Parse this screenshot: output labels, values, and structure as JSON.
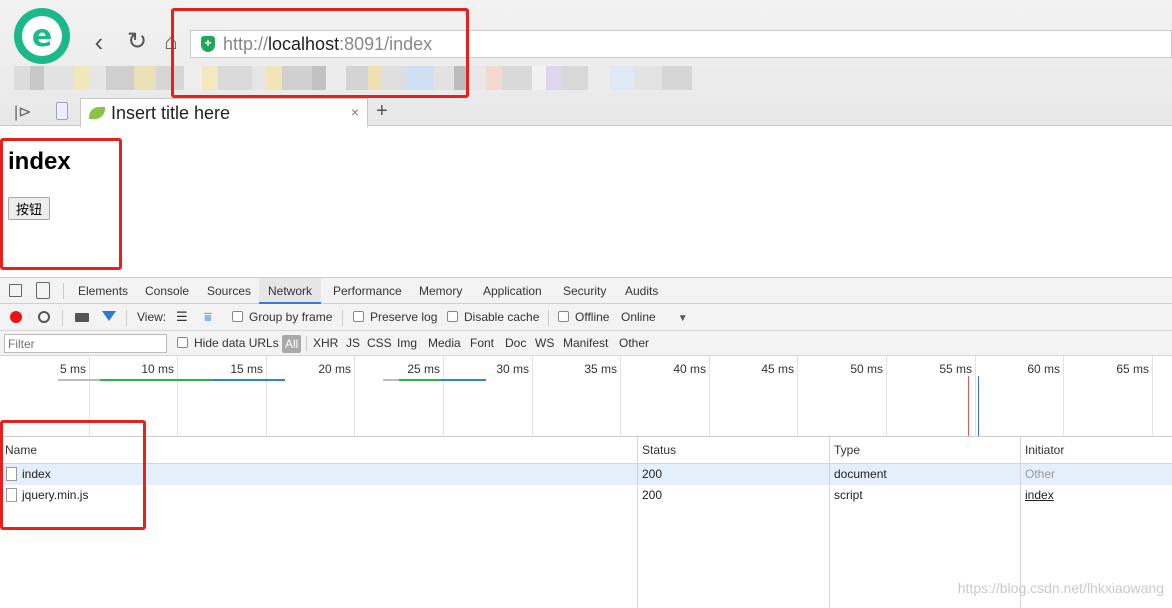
{
  "browser": {
    "address_scheme": "http://",
    "address_host": "localhost",
    "address_rest": ":8091/index",
    "tab_title": "Insert title here",
    "close_glyph": "×",
    "new_tab_glyph": "+"
  },
  "page": {
    "heading": "index",
    "button_label": "按钮"
  },
  "devtools": {
    "tabs": [
      "Elements",
      "Console",
      "Sources",
      "Network",
      "Performance",
      "Memory",
      "Application",
      "Security",
      "Audits"
    ],
    "active_tab": "Network",
    "toolbar": {
      "view_label": "View:",
      "group_by_frame": "Group by frame",
      "preserve_log": "Preserve log",
      "disable_cache": "Disable cache",
      "offline": "Offline",
      "throttling": "Online"
    },
    "filter": {
      "placeholder": "Filter",
      "hide_data_urls": "Hide data URLs",
      "types": [
        "All",
        "XHR",
        "JS",
        "CSS",
        "Img",
        "Media",
        "Font",
        "Doc",
        "WS",
        "Manifest",
        "Other"
      ]
    },
    "timeline_ticks": [
      "5 ms",
      "10 ms",
      "15 ms",
      "20 ms",
      "25 ms",
      "30 ms",
      "35 ms",
      "40 ms",
      "45 ms",
      "50 ms",
      "55 ms",
      "60 ms",
      "65 ms"
    ],
    "columns": {
      "name": "Name",
      "status": "Status",
      "type": "Type",
      "initiator": "Initiator"
    },
    "requests": [
      {
        "name": "index",
        "status": "200",
        "type": "document",
        "initiator": "Other"
      },
      {
        "name": "jquery.min.js",
        "status": "200",
        "type": "script",
        "initiator": "index"
      }
    ]
  },
  "watermark": "https://blog.csdn.net/lhkxiaowang",
  "colors": {
    "highlight": "#e5211d",
    "accent": "#3879d9",
    "selected_row": "#e3effb"
  }
}
